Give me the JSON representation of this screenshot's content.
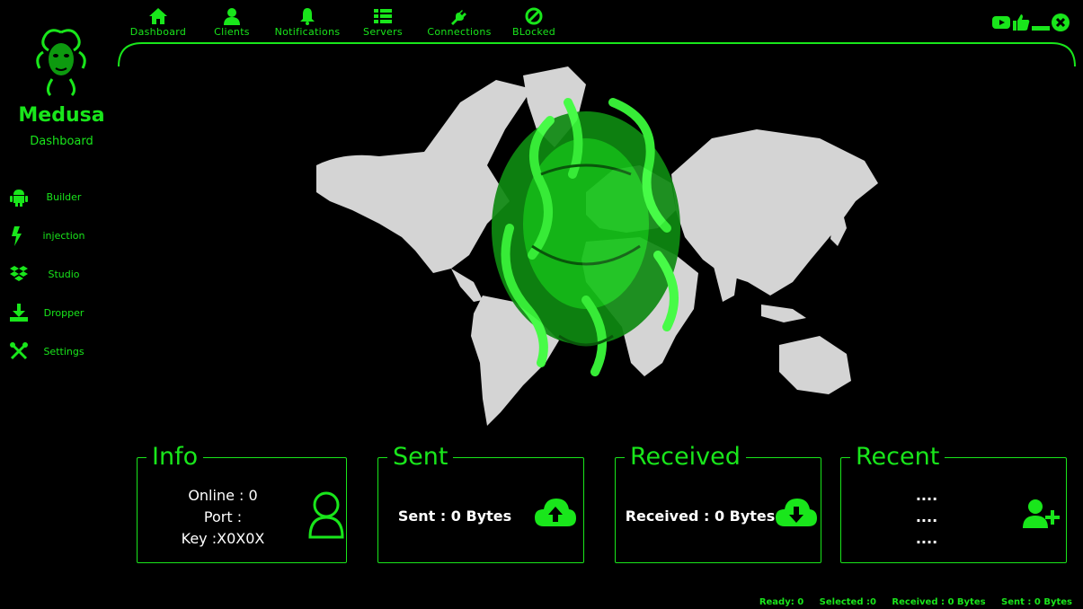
{
  "nav": {
    "items": [
      {
        "label": "Dashboard",
        "icon": "home-icon"
      },
      {
        "label": "Clients",
        "icon": "user-icon"
      },
      {
        "label": "Notifications",
        "icon": "bell-icon"
      },
      {
        "label": "Servers",
        "icon": "list-icon"
      },
      {
        "label": "Connections",
        "icon": "plug-icon"
      },
      {
        "label": "BLocked",
        "icon": "ban-icon"
      }
    ]
  },
  "window_controls": [
    "youtube-icon",
    "thumbs-up-icon",
    "minimize-icon",
    "close-icon"
  ],
  "sidebar": {
    "title": "Medusa",
    "subtitle": "Dashboard",
    "items": [
      {
        "label": "Builder",
        "icon": "android-icon"
      },
      {
        "label": "injection",
        "icon": "bolt-icon"
      },
      {
        "label": "Studio",
        "icon": "dropbox-icon"
      },
      {
        "label": "Dropper",
        "icon": "download-icon"
      },
      {
        "label": "Settings",
        "icon": "tools-icon"
      }
    ]
  },
  "cards": {
    "info": {
      "title": "Info",
      "online": "Online : 0",
      "port": "Port :",
      "key": "Key :X0X0X"
    },
    "sent": {
      "title": "Sent",
      "value": "Sent : 0 Bytes"
    },
    "received": {
      "title": "Received",
      "value": "Received : 0 Bytes"
    },
    "recent": {
      "title": "Recent",
      "lines": [
        "....",
        "....",
        "...."
      ]
    }
  },
  "status": {
    "ready": "Ready: 0",
    "selected": "Selected :0",
    "received": "Received : 0 Bytes",
    "sent": "Sent : 0 Bytes"
  },
  "colors": {
    "accent": "#19e61b",
    "background": "#000000",
    "map": "#d4d4d4"
  }
}
